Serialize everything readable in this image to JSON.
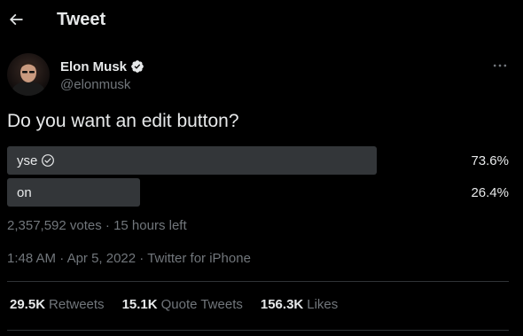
{
  "header": {
    "title": "Tweet"
  },
  "author": {
    "name": "Elon Musk",
    "handle": "@elonmusk",
    "verified": true
  },
  "tweet": {
    "text": "Do you want an edit button?"
  },
  "poll": {
    "options": [
      {
        "label": "yse",
        "percent_text": "73.6%",
        "fraction": 0.736,
        "selected": true
      },
      {
        "label": "on",
        "percent_text": "26.4%",
        "fraction": 0.264,
        "selected": false
      }
    ],
    "meta": "2,357,592 votes · 15 hours left"
  },
  "meta": {
    "time": "1:48 AM",
    "separator1": " · ",
    "date": "Apr 5, 2022",
    "separator2": " · ",
    "source": "Twitter for iPhone"
  },
  "stats": {
    "retweets_count": "29.5K",
    "retweets_label": "Retweets",
    "quotes_count": "15.1K",
    "quotes_label": "Quote Tweets",
    "likes_count": "156.3K",
    "likes_label": "Likes"
  },
  "icons": {
    "back": "arrow-left-icon",
    "verified": "verified-badge-icon",
    "more": "more-horizontal-icon",
    "check": "check-circle-icon"
  },
  "colors": {
    "background": "#000000",
    "text_primary": "#e7e9ea",
    "text_secondary": "#71767b",
    "poll_bar": "#333639",
    "divider": "#2f3336",
    "verified": "#e7e9ea"
  }
}
